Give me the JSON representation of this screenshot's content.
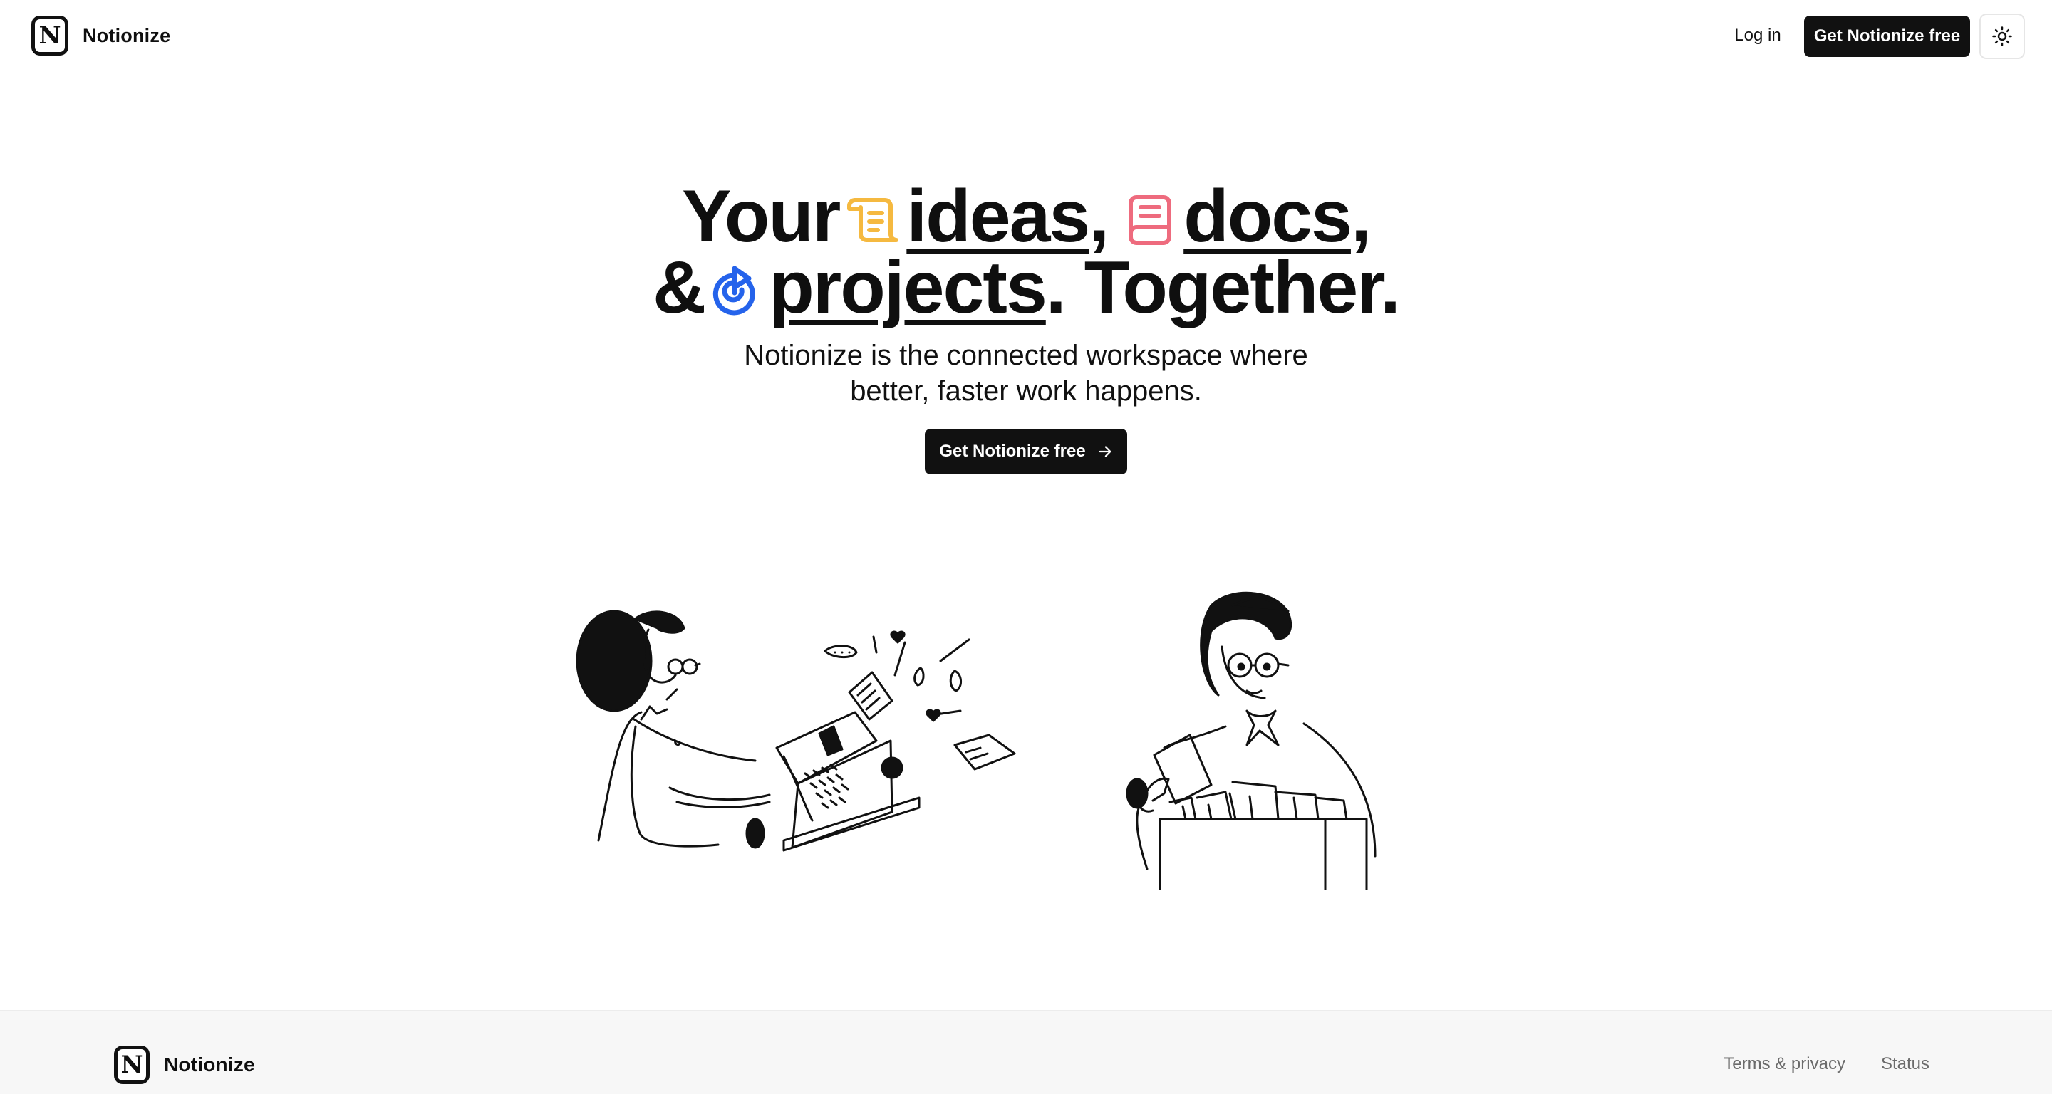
{
  "header": {
    "brand": "Notionize",
    "logo_letter": "N",
    "login": "Log in",
    "cta": "Get Notionize free",
    "theme_icon": "sun-icon"
  },
  "hero": {
    "line1": {
      "w1": "Your",
      "w2": "ideas",
      "c1": ",",
      "w3": "docs",
      "c2": ","
    },
    "line2": {
      "amp": "&",
      "w4": "projects",
      "tail": ". Together."
    },
    "icons": [
      "scroll-icon",
      "book-icon",
      "target-icon"
    ],
    "sub1": "Notionize is the connected workspace where",
    "sub2": "better, faster work happens.",
    "cta": "Get Notionize free"
  },
  "footer": {
    "brand": "Notionize",
    "logo_letter": "N",
    "links": [
      "Terms & privacy",
      "Status"
    ]
  },
  "colors": {
    "accent_dark": "#111111",
    "scroll_icon": "#f5b940",
    "book_icon": "#ee6b7e",
    "target_icon": "#2563eb"
  }
}
